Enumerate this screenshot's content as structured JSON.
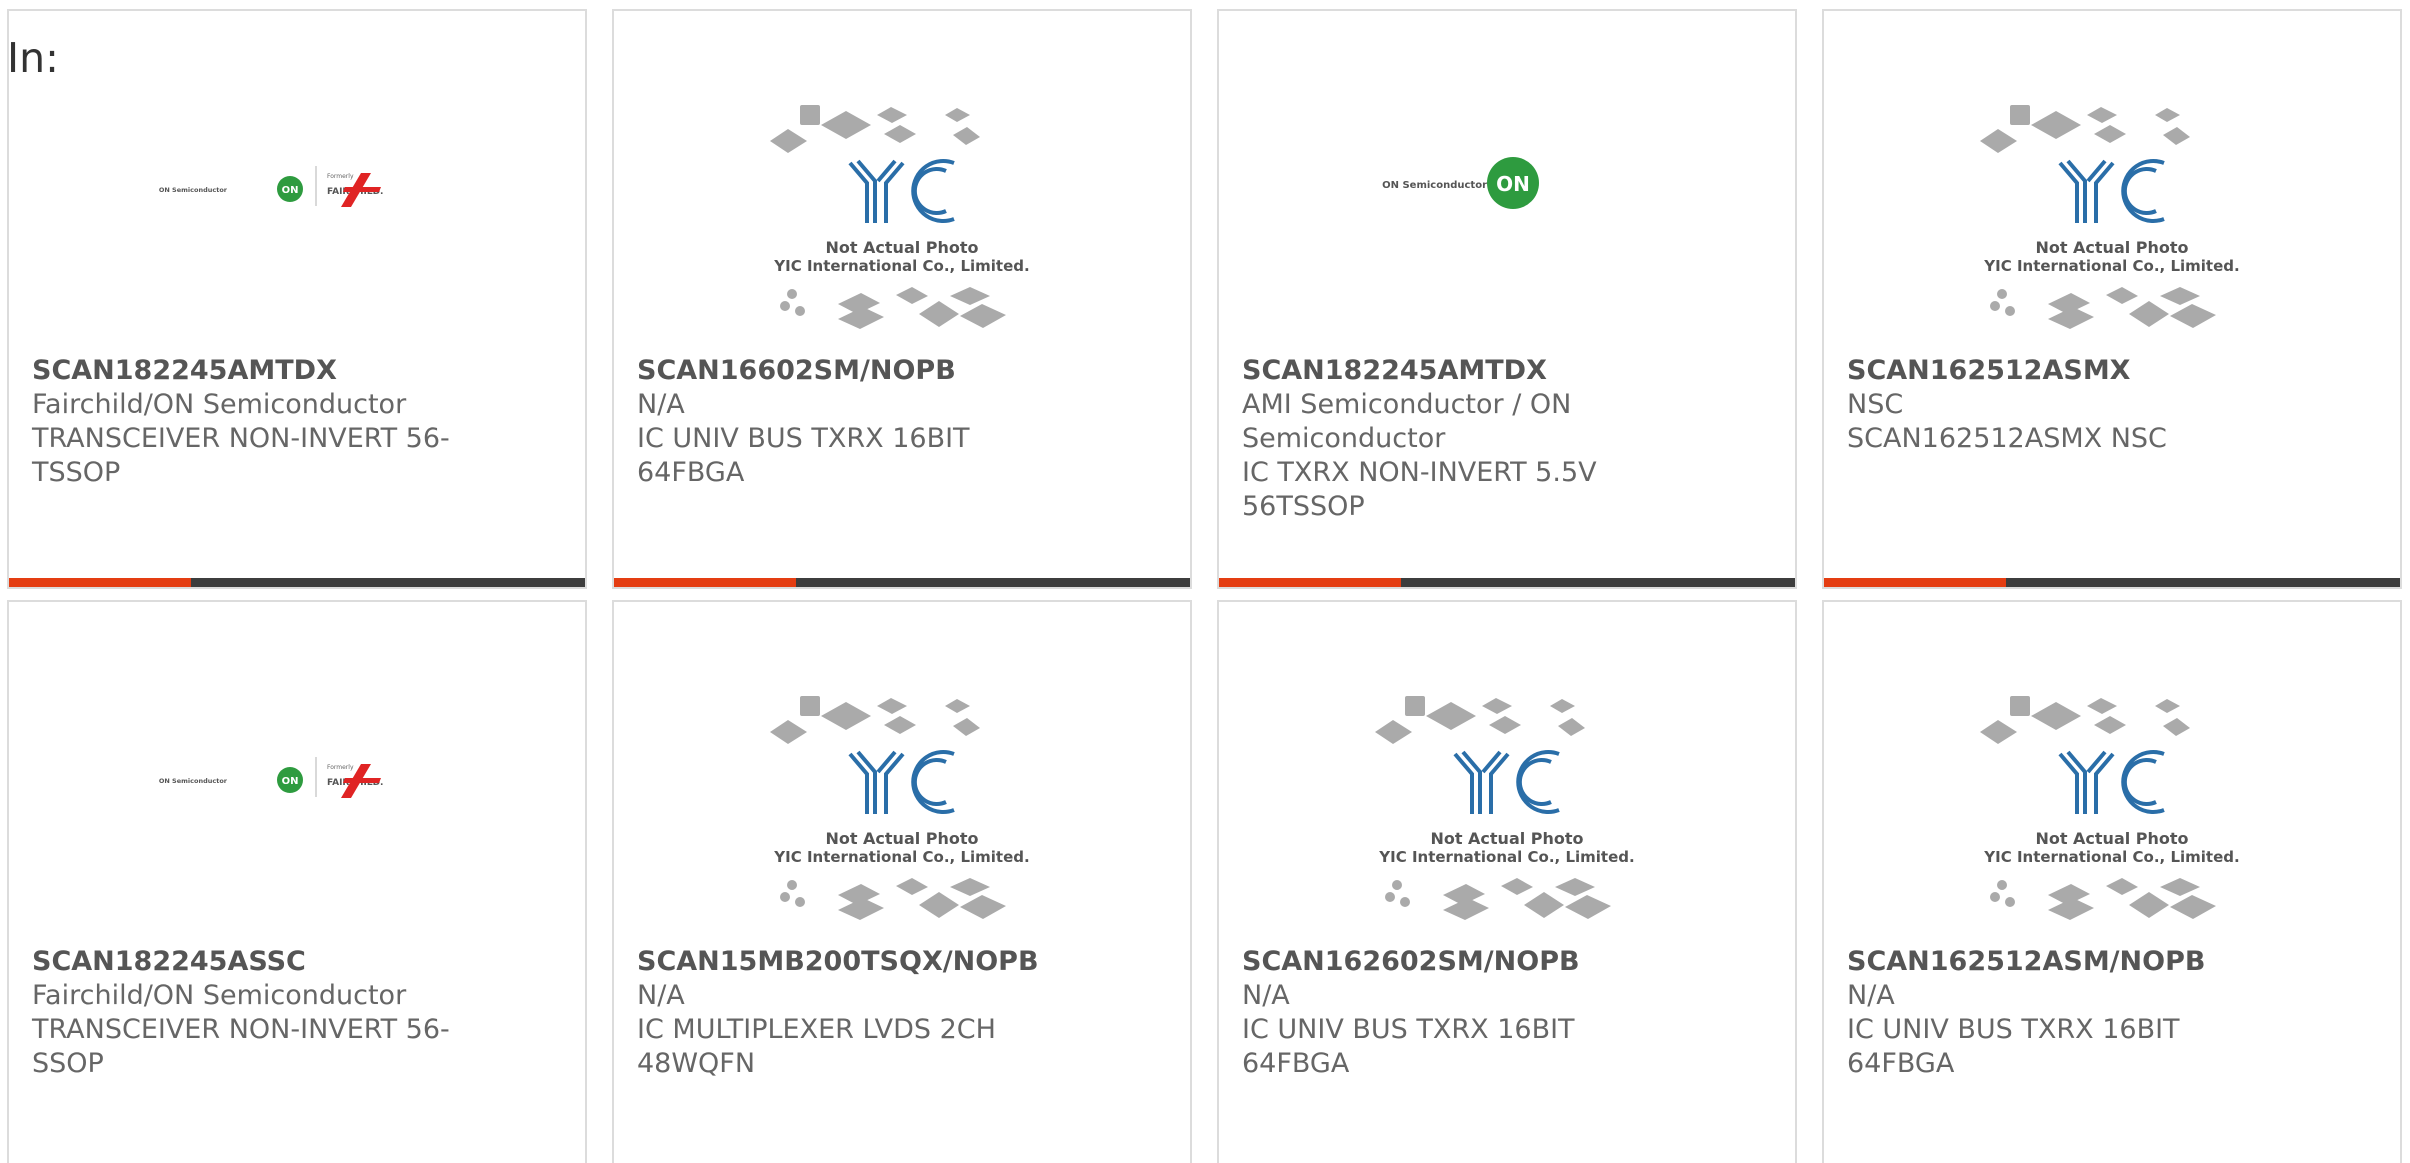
{
  "header": {
    "in_label": "In:"
  },
  "images": {
    "placeholder_line1": "Not Actual Photo",
    "placeholder_line2": "YIC International Co., Limited.",
    "brand_on": "ON Semiconductor",
    "on_badge": "ON",
    "formerly": "Formerly",
    "fairchild": "FAIRCHILD."
  },
  "colors": {
    "accent": "#e43d12",
    "bar": "#3d3d3d",
    "yic_blue": "#2a6ea8",
    "on_green": "#2e9b3f",
    "fairchild_red": "#e02424"
  },
  "products": [
    {
      "part": "SCAN182245AMTDX",
      "manufacturer": "Fairchild/ON Semiconductor",
      "description": "TRANSCEIVER NON-INVERT 56-TSSOP",
      "image": "onsemi-fairchild-logo"
    },
    {
      "part": "SCAN16602SM/NOPB",
      "manufacturer": "N/A",
      "description": "IC UNIV BUS TXRX 16BIT 64FBGA",
      "image": "yic-placeholder"
    },
    {
      "part": "SCAN182245AMTDX",
      "manufacturer": "AMI Semiconductor / ON Semiconductor",
      "description": "IC TXRX NON-INVERT 5.5V 56TSSOP",
      "image": "onsemi-logo"
    },
    {
      "part": "SCAN162512ASMX",
      "manufacturer": "NSC",
      "description": "SCAN162512ASMX NSC",
      "image": "yic-placeholder"
    },
    {
      "part": "SCAN182245ASSC",
      "manufacturer": "Fairchild/ON Semiconductor",
      "description": "TRANSCEIVER NON-INVERT 56-SSOP",
      "image": "onsemi-fairchild-logo"
    },
    {
      "part": "SCAN15MB200TSQX/NOPB",
      "manufacturer": "N/A",
      "description": "IC MULTIPLEXER LVDS 2CH 48WQFN",
      "image": "yic-placeholder"
    },
    {
      "part": "SCAN162602SM/NOPB",
      "manufacturer": "N/A",
      "description": "IC UNIV BUS TXRX 16BIT 64FBGA",
      "image": "yic-placeholder"
    },
    {
      "part": "SCAN162512ASM/NOPB",
      "manufacturer": "N/A",
      "description": "IC UNIV BUS TXRX 16BIT 64FBGA",
      "image": "yic-placeholder"
    }
  ]
}
